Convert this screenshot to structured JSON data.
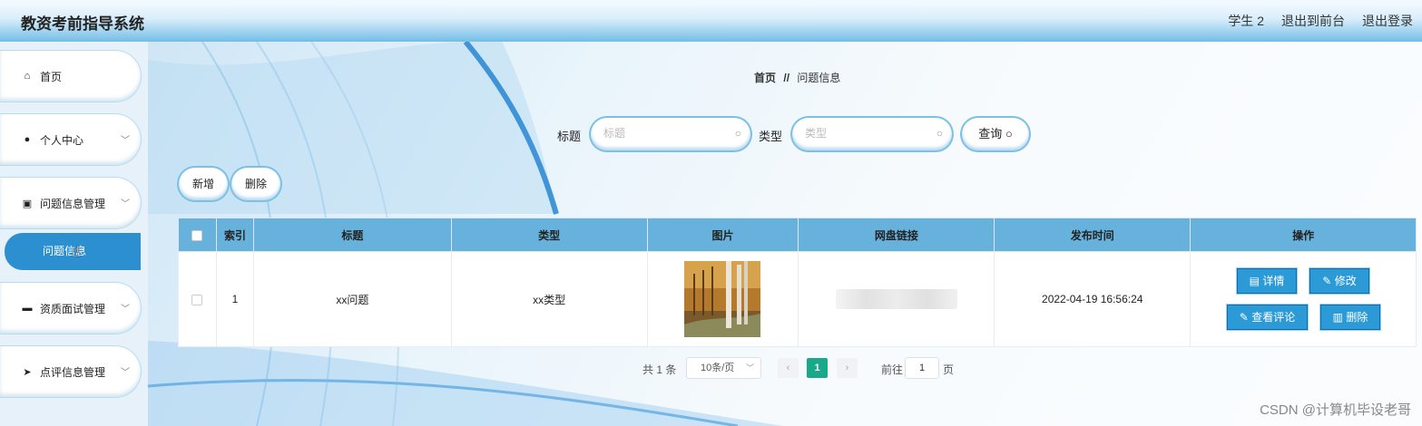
{
  "header": {
    "title": "教资考前指导系统",
    "user": "学生 2",
    "to_front": "退出到前台",
    "logout": "退出登录"
  },
  "sidebar": {
    "items": [
      {
        "label": "首页"
      },
      {
        "label": "个人中心"
      },
      {
        "label": "问题信息管理"
      },
      {
        "label": "资质面试管理"
      },
      {
        "label": "点评信息管理"
      }
    ],
    "active_sub": "问题信息"
  },
  "breadcrumb": {
    "home": "首页",
    "sep": "//",
    "current": "问题信息"
  },
  "search": {
    "title_label": "标题",
    "title_placeholder": "标题",
    "type_label": "类型",
    "type_placeholder": "类型",
    "query_label": "查询 ○"
  },
  "actions": {
    "add": "新增",
    "delete": "删除"
  },
  "table": {
    "headers": [
      "索引",
      "标题",
      "类型",
      "图片",
      "网盘链接",
      "发布时间",
      "操作"
    ],
    "rows": [
      {
        "index": "1",
        "title": "xx问题",
        "type": "xx类型",
        "time": "2022-04-19 16:56:24"
      }
    ],
    "ops": {
      "detail": "详情",
      "edit": "修改",
      "comments": "查看评论",
      "remove": "删除"
    }
  },
  "pagination": {
    "total": "共 1 条",
    "page_size": "10条/页",
    "current": "1",
    "goto_label": "前往",
    "goto_value": "1",
    "page_unit": "页"
  },
  "watermark": "CSDN @计算机毕设老哥"
}
